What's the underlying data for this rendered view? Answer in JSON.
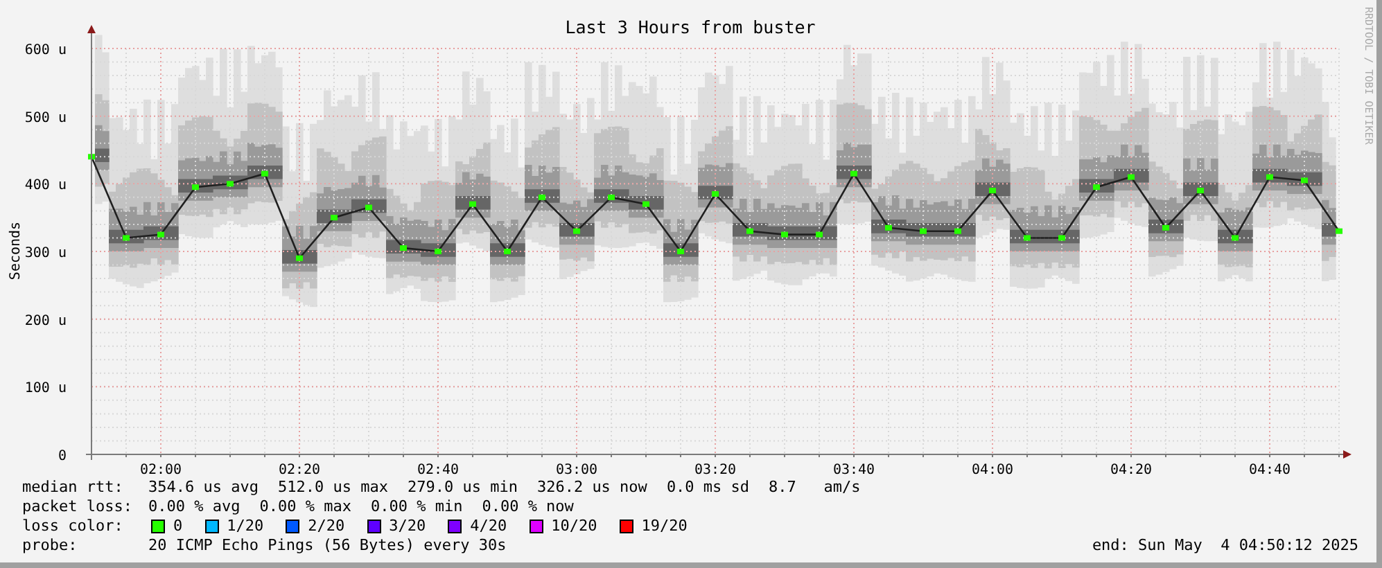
{
  "chart": {
    "watermark": "RRDTOOL / TOBI OETIKER",
    "chart_data": {
      "type": "line",
      "title": "Last 3 Hours from buster",
      "ylabel": "Seconds",
      "categories": [
        null,
        null,
        "02:00",
        null,
        null,
        null,
        "02:20",
        null,
        null,
        null,
        "02:40",
        null,
        null,
        null,
        "03:00",
        null,
        null,
        null,
        "03:20",
        null,
        null,
        null,
        "03:40",
        null,
        null,
        null,
        "04:00",
        null,
        null,
        null,
        "04:20",
        null,
        null,
        null,
        "04:40",
        null,
        null
      ],
      "grid": true,
      "series": [
        {
          "color": "#202020",
          "marker": "square",
          "values": [
            440,
            320,
            325,
            395,
            400,
            415,
            290,
            350,
            365,
            305,
            300,
            370,
            300,
            380,
            330,
            380,
            370,
            300,
            385,
            330,
            325,
            325,
            415,
            335,
            330,
            330,
            390,
            320,
            320,
            395,
            410,
            335,
            390,
            320,
            410,
            405,
            330
          ]
        }
      ],
      "ylim": [
        0,
        600
      ],
      "yticks": [
        {
          "value": 0,
          "label": "0"
        },
        {
          "value": 100,
          "label": "100 u"
        },
        {
          "value": 200,
          "label": "200 u"
        },
        {
          "value": 300,
          "label": "300 u"
        },
        {
          "value": 400,
          "label": "400 u"
        },
        {
          "value": 500,
          "label": "500 u"
        },
        {
          "value": 600,
          "label": "600 u"
        }
      ]
    }
  },
  "legend": {
    "median_rtt": {
      "label": "median rtt:",
      "values": [
        "354.6 us avg",
        "512.0 us max",
        "279.0 us min",
        "326.2 us now",
        "0.0 ms sd",
        "8.7   am/s"
      ]
    },
    "packet_loss": {
      "label": "packet loss:",
      "values": [
        "0.00 % avg",
        "0.00 % max",
        "0.00 % min",
        "0.00 % now"
      ]
    },
    "loss_color": {
      "label": "loss color:",
      "items": [
        {
          "label": "0",
          "color": "#26ff00"
        },
        {
          "label": "1/20",
          "color": "#00b8ff"
        },
        {
          "label": "2/20",
          "color": "#0059ff"
        },
        {
          "label": "3/20",
          "color": "#5e00ff"
        },
        {
          "label": "4/20",
          "color": "#7e00ff"
        },
        {
          "label": "10/20",
          "color": "#dd00ff"
        },
        {
          "label": "19/20",
          "color": "#ff0000"
        }
      ]
    },
    "probe": {
      "label": "probe:",
      "value": "20 ICMP Echo Pings (56 Bytes) every 30s"
    },
    "end": "end: Sun May  4 04:50:12 2025"
  }
}
